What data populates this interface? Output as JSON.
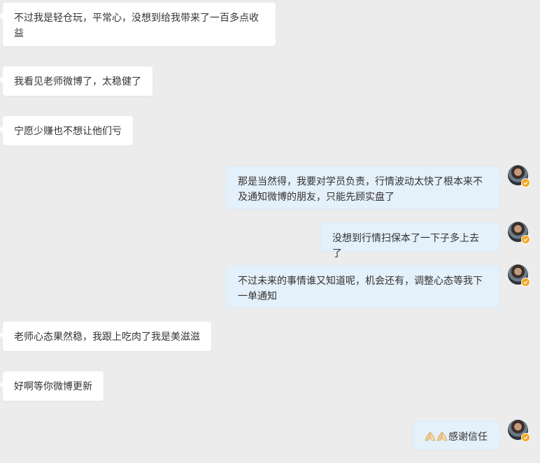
{
  "messages": [
    {
      "side": "left",
      "text": "不过我是轻仓玩，平常心，没想到给我带来了一百多点收益"
    },
    {
      "side": "left",
      "text": "我看见老师微博了，太稳健了"
    },
    {
      "side": "left",
      "text": "宁愿少赚也不想让他们亏"
    },
    {
      "side": "right",
      "text": "那是当然得，我要对学员负责，行情波动太快了根本来不及通知微博的朋友，只能先顾实盘了"
    },
    {
      "side": "right",
      "text": "没想到行情扫保本了一下子多上去了"
    },
    {
      "side": "right",
      "text": "不过未来的事情谁又知道呢，机会还有，调整心态等我下一单通知"
    },
    {
      "side": "left",
      "text": "老师心态果然稳，我跟上吃肉了我是美滋滋"
    },
    {
      "side": "left",
      "text": "好啊等你微博更新"
    },
    {
      "side": "right",
      "text": "感谢信任",
      "emoji": [
        "folded-hands-icon",
        "folded-hands-icon"
      ]
    }
  ],
  "colors": {
    "background": "#ececec",
    "left_bubble": "#ffffff",
    "right_bubble": "#e4f0fa",
    "text": "#333333",
    "badge": "#f5a623"
  }
}
